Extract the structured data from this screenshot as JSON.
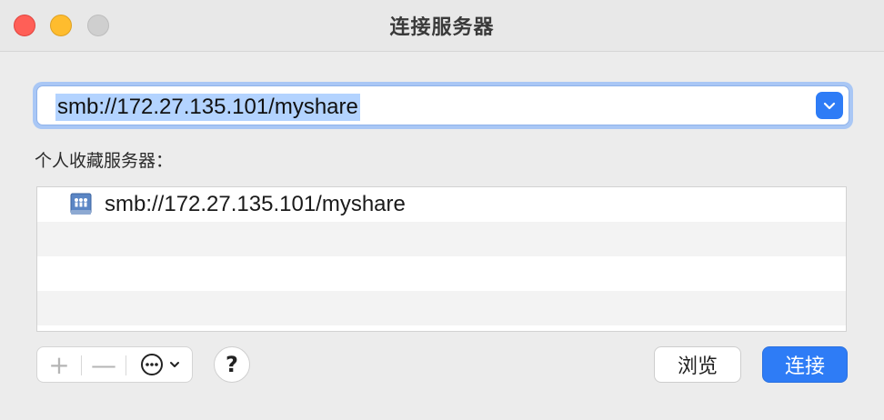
{
  "window": {
    "title": "连接服务器",
    "traffic_lights": {
      "close": "#ff5f57",
      "minimize": "#febc2e",
      "zoom": "#cfcfcf"
    }
  },
  "address": {
    "value": "smb://172.27.135.101/myshare",
    "dropdown_icon": "chevron-down-icon",
    "accent": "#2e7cf6"
  },
  "favorites": {
    "label": "个人收藏服务器：",
    "items": [
      {
        "icon": "network-share-icon",
        "label": "smb://172.27.135.101/myshare"
      }
    ]
  },
  "toolbar": {
    "add_label": "+",
    "remove_label": "—",
    "more_icon": "ellipsis-circle-icon",
    "help_label": "?",
    "browse_label": "浏览",
    "connect_label": "连接"
  }
}
